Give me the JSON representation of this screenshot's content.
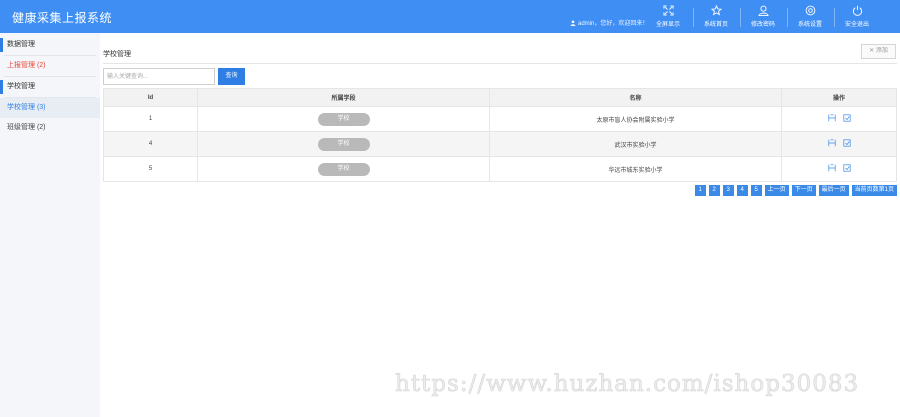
{
  "app": {
    "title": "健康采集上报系统"
  },
  "header": {
    "welcome_text": "admin，您好，欢迎回来！",
    "nav": [
      {
        "label": "全屏显示",
        "icon": "fullscreen-icon"
      },
      {
        "label": "系统首页",
        "icon": "star-icon"
      },
      {
        "label": "修改密码",
        "icon": "user-icon"
      },
      {
        "label": "系统设置",
        "icon": "settings-icon"
      },
      {
        "label": "安全退出",
        "icon": "power-icon"
      }
    ]
  },
  "sidebar": {
    "groups": [
      {
        "title": "数据管理",
        "items": [
          {
            "label": "上报管理 (2)",
            "state": "alert"
          }
        ]
      },
      {
        "title": "学校管理",
        "items": [
          {
            "label": "学校管理 (3)",
            "state": "active"
          },
          {
            "label": "班级管理 (2)",
            "state": "normal"
          }
        ]
      }
    ]
  },
  "page": {
    "heading": "学校管理",
    "add_label": "添加",
    "search": {
      "placeholder": "输入关键查询...",
      "button_label": "查询"
    },
    "table": {
      "columns": [
        "Id",
        "所属学段",
        "名称",
        "操作"
      ],
      "rows": [
        {
          "id": "1",
          "stage": "学校",
          "name": "太原市盲人协会附属实验小学"
        },
        {
          "id": "4",
          "stage": "学校",
          "name": "武汉市实验小学"
        },
        {
          "id": "5",
          "stage": "学校",
          "name": "华远市城东实验小学"
        }
      ]
    },
    "pagination": [
      "1",
      "2",
      "3",
      "4",
      "5",
      "上一页",
      "下一页",
      "最后一页",
      "当前页数第1页"
    ]
  },
  "watermark": "https://www.huzhan.com/ishop30083",
  "colors": {
    "header_bg": "#3f8ef3",
    "accent": "#2e7ee6",
    "alert": "#e8463c",
    "tag_bg": "#b9b9b9"
  }
}
